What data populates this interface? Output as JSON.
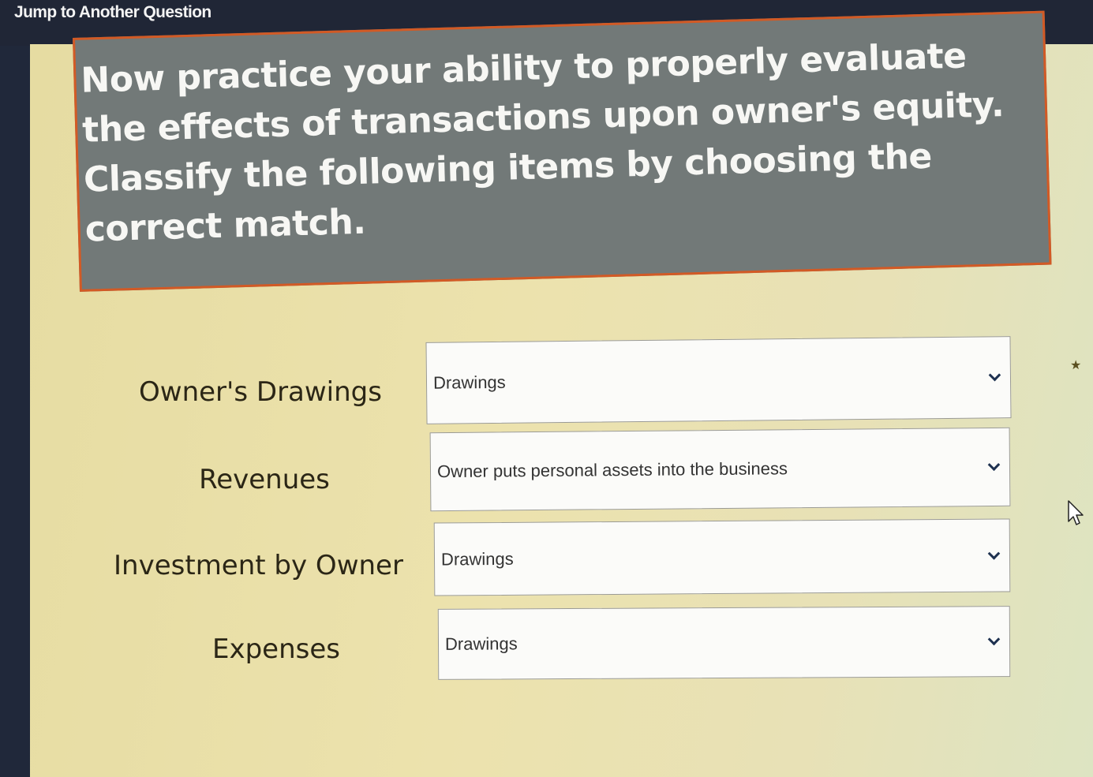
{
  "header": {
    "jump_link": "Jump to Another Question"
  },
  "instructions": {
    "text": "Now practice your ability to properly evaluate the effects of transactions upon owner's equity. Classify the following items by choosing the correct match."
  },
  "rows": [
    {
      "label": "Owner's Drawings",
      "selected": "Drawings"
    },
    {
      "label": "Revenues",
      "selected": "Owner puts personal assets into the business"
    },
    {
      "label": "Investment by Owner",
      "selected": "Drawings"
    },
    {
      "label": "Expenses",
      "selected": "Drawings"
    }
  ],
  "icons": {
    "dropdown": "chevron-down-icon",
    "pointer": "mouse-pointer-icon",
    "marker": "star-marker-icon"
  },
  "colors": {
    "top_bar": "#202636",
    "instruction_bg": "#727978",
    "instruction_border": "#d25a25",
    "content_bg": "#e6dca2"
  }
}
